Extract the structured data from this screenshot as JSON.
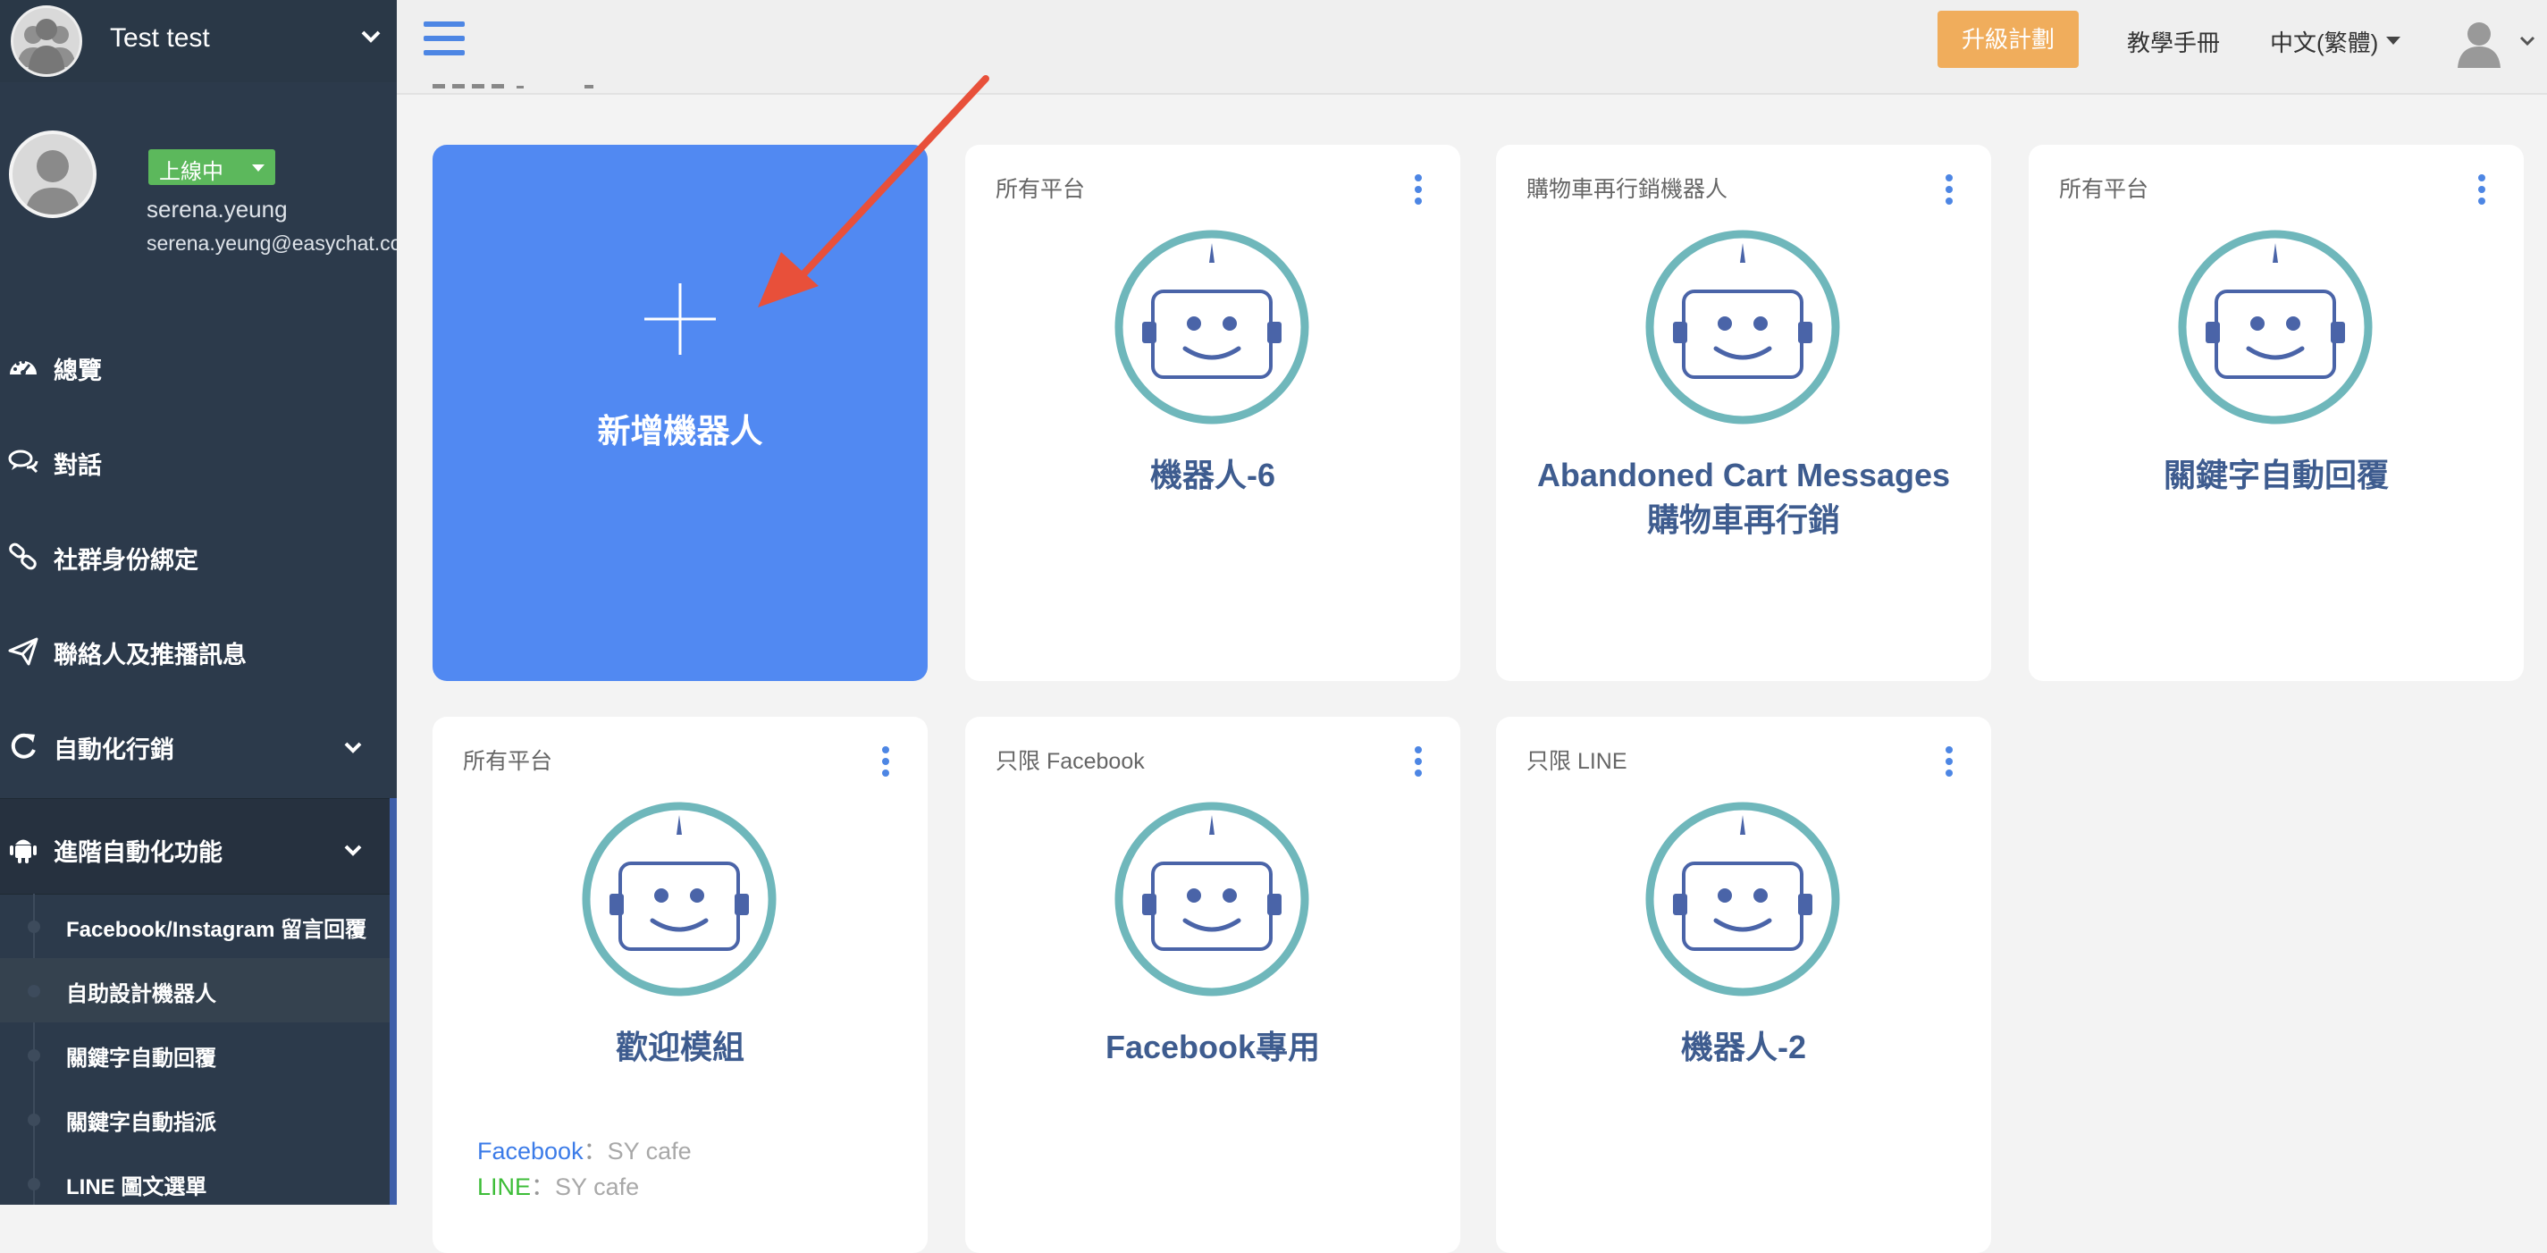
{
  "sidebar": {
    "team_name": "Test test",
    "status": "上線中",
    "user_name": "serena.yeung",
    "user_email": "serena.yeung@easychat.co",
    "nav": [
      {
        "label": "總覽",
        "icon": "dashboard-icon"
      },
      {
        "label": "對話",
        "icon": "chat-bubbles-icon"
      },
      {
        "label": "社群身份綁定",
        "icon": "link-icon"
      },
      {
        "label": "聯絡人及推播訊息",
        "icon": "paper-plane-icon"
      },
      {
        "label": "自動化行銷",
        "icon": "refresh-icon"
      },
      {
        "label": "進階自動化功能",
        "icon": "android-icon"
      }
    ],
    "sub_items": [
      {
        "label": "Facebook/Instagram 留言回覆"
      },
      {
        "label": "自助設計機器人"
      },
      {
        "label": "關鍵字自動回覆"
      },
      {
        "label": "關鍵字自動指派"
      },
      {
        "label": "LINE 圖文選單"
      }
    ]
  },
  "topbar": {
    "upgrade_label": "升級計劃",
    "manual_label": "教學手冊",
    "language": "中文(繁體)"
  },
  "new_bot": {
    "label": "新增機器人"
  },
  "bots": [
    {
      "platform": "所有平台",
      "title": "機器人-6"
    },
    {
      "platform": "購物車再行銷機器人",
      "title": "Abandoned Cart Messages 購物車再行銷"
    },
    {
      "platform": "所有平台",
      "title": "關鍵字自動回覆"
    },
    {
      "platform": "所有平台",
      "title": "歡迎模組",
      "pages": {
        "facebook_label": "Facebook",
        "facebook_value": "SY cafe",
        "line_label": "LINE",
        "line_value": "SY cafe",
        "sep": "："
      }
    },
    {
      "platform": "只限 Facebook",
      "title": "Facebook專用"
    },
    {
      "platform": "只限 LINE",
      "title": "機器人-2"
    }
  ],
  "colors": {
    "sidebar_bg": "#2c3a4b",
    "new_card_bg": "#5189f2",
    "upgrade_bg": "#f0ad5c",
    "status_green": "#5cb85c",
    "robot_ring": "#6fb7bb",
    "robot_face": "#4a64a8",
    "annotation_arrow": "#e8503a"
  }
}
